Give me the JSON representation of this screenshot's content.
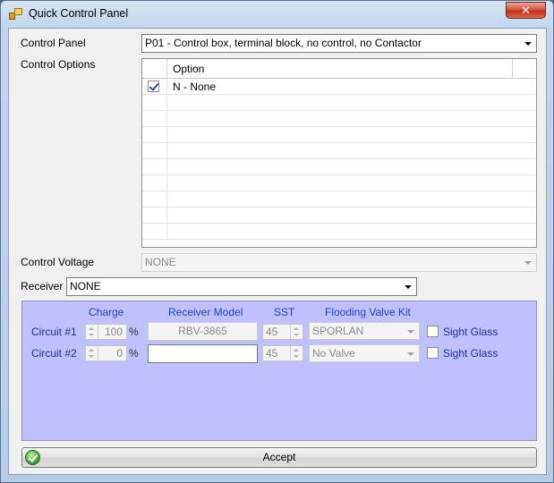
{
  "window": {
    "title": "Quick Control Panel",
    "close_label": "✕"
  },
  "control_panel": {
    "label": "Control Panel",
    "selected": "P01 - Control box, terminal block, no control, no Contactor"
  },
  "control_options": {
    "label": "Control Options",
    "column_header": "Option",
    "rows": [
      {
        "checked": true,
        "option": "N - None"
      }
    ]
  },
  "control_voltage": {
    "label": "Control Voltage",
    "selected": "NONE"
  },
  "receiver": {
    "label": "Receiver",
    "selected": "NONE"
  },
  "circuits_panel": {
    "headers": {
      "charge": "Charge",
      "receiver_model": "Receiver Model",
      "sst": "SST",
      "flooding_valve_kit": "Flooding Valve Kit"
    },
    "circuits": [
      {
        "label": "Circuit #1",
        "charge": "100",
        "charge_unit": "%",
        "receiver_model": "RBV-3865",
        "sst": "45",
        "flooding_valve_kit": "SPORLAN",
        "sight_glass_label": "Sight Glass",
        "sight_glass_checked": false
      },
      {
        "label": "Circuit #2",
        "charge": "0",
        "charge_unit": "%",
        "receiver_model": "",
        "sst": "45",
        "flooding_valve_kit": "No Valve",
        "sight_glass_label": "Sight Glass",
        "sight_glass_checked": false
      }
    ]
  },
  "accept_button": {
    "label": "Accept"
  },
  "icons": {
    "app": "app-icon",
    "accept": "ok-check-icon",
    "close": "close-icon"
  }
}
